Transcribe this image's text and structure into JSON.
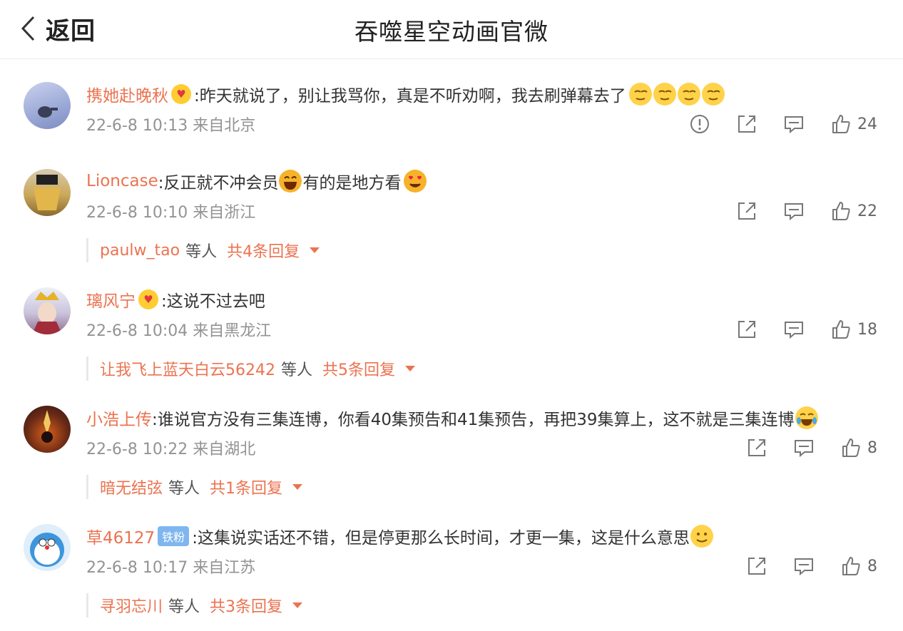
{
  "header": {
    "back_label": "返回",
    "title": "吞噬星空动画官微"
  },
  "comments": [
    {
      "user": "携她赴晚秋",
      "text": ":昨天就说了，别让我骂你，真是不听劝啊，我去刷弹幕去了",
      "time": "22-6-8 10:13",
      "from": "来自北京",
      "likes": "24"
    },
    {
      "user": "Lioncase",
      "text_a": ":反正就不冲会员",
      "text_b": "有的是地方看",
      "time": "22-6-8 10:10",
      "from": "来自浙江",
      "likes": "22",
      "reply_user": "paulw_tao",
      "reply_etc": "等人",
      "reply_total": "共4条回复"
    },
    {
      "user": "璃风宁",
      "text": ":这说不过去吧",
      "time": "22-6-8 10:04",
      "from": "来自黑龙江",
      "likes": "18",
      "reply_user": "让我飞上蓝天白云56242",
      "reply_etc": "等人",
      "reply_total": "共5条回复"
    },
    {
      "user": "小浩上传",
      "text": ":谁说官方没有三集连博，你看40集预告和41集预告，再把39集算上，这不就是三集连博",
      "time": "22-6-8 10:22",
      "from": "来自湖北",
      "likes": "8",
      "reply_user": "暗无结弦",
      "reply_etc": "等人",
      "reply_total": "共1条回复"
    },
    {
      "user": "草46127",
      "badge": "铁粉",
      "text": ":这集说实话还不错，但是停更那么长时间，才更一集，这是什么意思",
      "time": "22-6-8 10:17",
      "from": "来自江苏",
      "likes": "8",
      "reply_user": "寻羽忘川",
      "reply_etc": "等人",
      "reply_total": "共3条回复"
    }
  ],
  "icons": {
    "report": "exclamation-circle-icon",
    "share": "share-icon",
    "comment": "comment-icon",
    "like": "thumbs-up-icon"
  },
  "colors": {
    "username": "#eb7350",
    "meta": "#939393",
    "text": "#333333"
  }
}
